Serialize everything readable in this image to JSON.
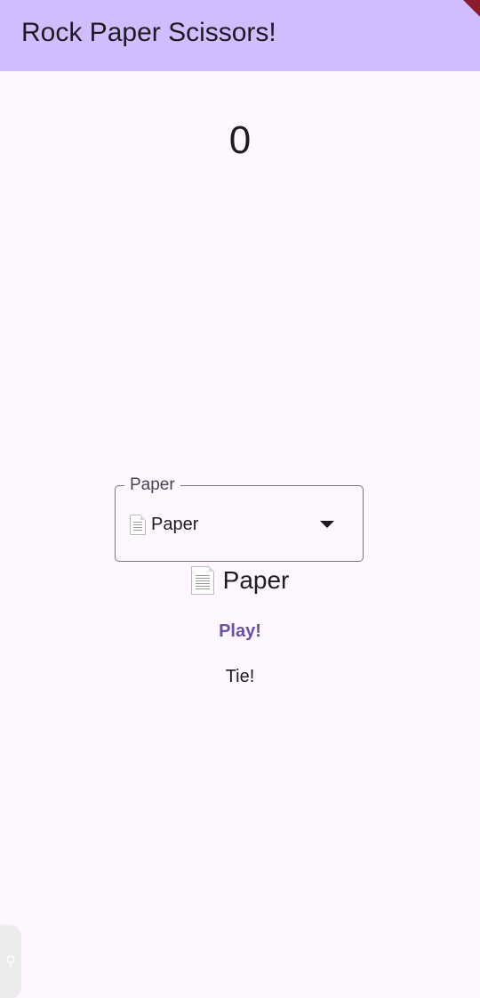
{
  "app_bar": {
    "title": "Rock Paper Scissors!",
    "background": "#d1bcff"
  },
  "score": "0",
  "dropdown": {
    "label": "Paper",
    "selected_icon": "document-icon",
    "selected_value": "Paper"
  },
  "selection": {
    "icon": "document-icon",
    "text": "Paper"
  },
  "play_button": {
    "label": "Play!",
    "color": "#6750a4"
  },
  "result": "Tie!",
  "accessibility_tab": {
    "icon": "accessibility-icon"
  }
}
